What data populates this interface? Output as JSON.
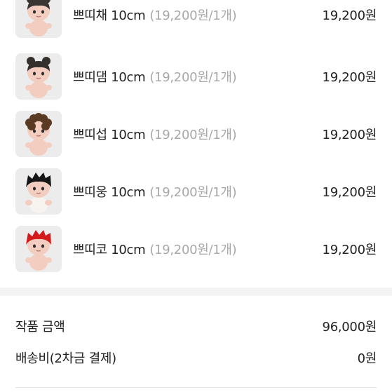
{
  "items": [
    {
      "name": "쁘띠채 10cm",
      "unit_price": "(19,200원/1개)",
      "price": "19,200원",
      "hair_color": "#3a3533",
      "hair_style": "buns"
    },
    {
      "name": "쁘띠댐 10cm",
      "unit_price": "(19,200원/1개)",
      "price": "19,200원",
      "hair_color": "#33302e",
      "hair_style": "buns"
    },
    {
      "name": "쁘띠섭 10cm",
      "unit_price": "(19,200원/1개)",
      "price": "19,200원",
      "hair_color": "#5a3a22",
      "hair_style": "curly"
    },
    {
      "name": "쁘띠웅 10cm",
      "unit_price": "(19,200원/1개)",
      "price": "19,200원",
      "hair_color": "#151515",
      "hair_style": "spiky"
    },
    {
      "name": "쁘띠코 10cm",
      "unit_price": "(19,200원/1개)",
      "price": "19,200원",
      "hair_color": "#d41a1a",
      "hair_style": "spiky"
    }
  ],
  "summary": {
    "subtotal_label": "작품 금액",
    "subtotal_value": "96,000원",
    "shipping_label": "배송비(2차금 결제)",
    "shipping_value": "0원"
  },
  "colors": {
    "text": "#222222",
    "muted": "#a8a8a8",
    "divider": "#f4f4f4",
    "skin": "#f3cdbf"
  }
}
